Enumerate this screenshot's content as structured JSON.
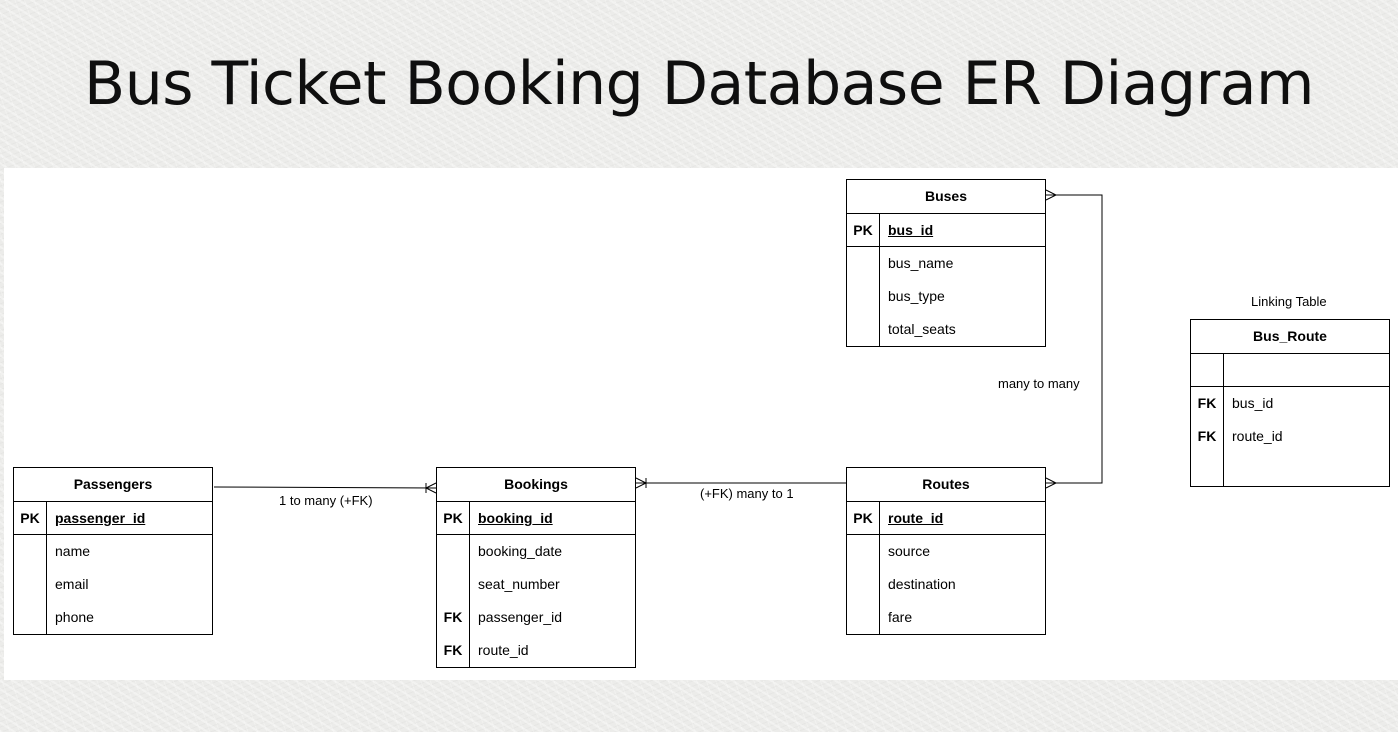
{
  "title": "Bus Ticket Booking Database ER Diagram",
  "entities": {
    "passengers": {
      "name": "Passengers",
      "pk": {
        "key": "PK",
        "field": "passenger_id"
      },
      "fields": [
        {
          "key": "",
          "field": "name"
        },
        {
          "key": "",
          "field": "email"
        },
        {
          "key": "",
          "field": "phone"
        }
      ]
    },
    "bookings": {
      "name": "Bookings",
      "pk": {
        "key": "PK",
        "field": "booking_id"
      },
      "fields": [
        {
          "key": "",
          "field": "booking_date"
        },
        {
          "key": "",
          "field": "seat_number"
        },
        {
          "key": "FK",
          "field": "passenger_id"
        },
        {
          "key": "FK",
          "field": "route_id"
        }
      ]
    },
    "routes": {
      "name": "Routes",
      "pk": {
        "key": "PK",
        "field": "route_id"
      },
      "fields": [
        {
          "key": "",
          "field": "source"
        },
        {
          "key": "",
          "field": "destination"
        },
        {
          "key": "",
          "field": "fare"
        }
      ]
    },
    "buses": {
      "name": "Buses",
      "pk": {
        "key": "PK",
        "field": "bus_id"
      },
      "fields": [
        {
          "key": "",
          "field": "bus_name"
        },
        {
          "key": "",
          "field": "bus_type"
        },
        {
          "key": "",
          "field": "total_seats"
        }
      ]
    },
    "bus_route": {
      "name": "Bus_Route",
      "pk": {
        "key": "",
        "field": ""
      },
      "fields": [
        {
          "key": "FK",
          "field": "bus_id"
        },
        {
          "key": "FK",
          "field": "route_id"
        },
        {
          "key": "",
          "field": ""
        }
      ]
    }
  },
  "relationships": {
    "passengers_bookings": "1 to many (+FK)",
    "routes_bookings": "(+FK) many to 1",
    "buses_routes": "many to many"
  },
  "linking_table_label": "Linking Table"
}
